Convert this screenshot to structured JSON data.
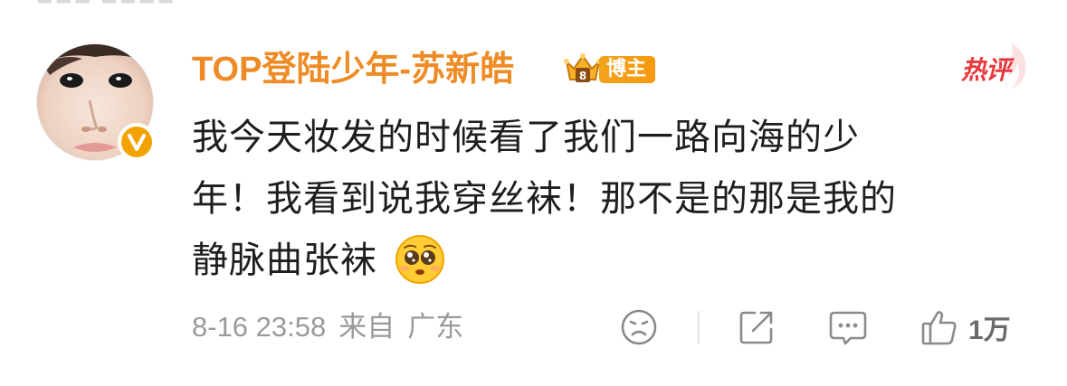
{
  "comment": {
    "author": {
      "name": "TOP登陆少年-苏新皓",
      "badge_label": "博主",
      "avatar": "user-avatar-photo",
      "verified_icon": "verified-v-icon"
    },
    "hot_tag": "热评",
    "text": "我今天妆发的时候看了我们一路向海的少年！我看到说我穿丝袜！那不是的那是我的静脉曲张袜",
    "text_lines": [
      "我今天妆发的时候看了我们一路向海的少",
      "年！我看到说我穿丝袜！那不是的那是我的",
      "静脉曲张袜"
    ],
    "emoji": "pleading-face-emoji",
    "time": "8-16 23:58",
    "source_prefix": "来自",
    "location": "广东",
    "likes": "1万"
  },
  "actions": {
    "dislike_icon": "frown-face-icon",
    "share_icon": "share-icon",
    "reply_icon": "comment-icon",
    "like_icon": "thumbs-up-icon"
  },
  "colors": {
    "username": "#ee8b25",
    "badge": "#f3a21c",
    "hot": "#e8393d",
    "text": "#1e1e1e",
    "meta": "#9a9a9a",
    "verified": "#f3a300"
  }
}
